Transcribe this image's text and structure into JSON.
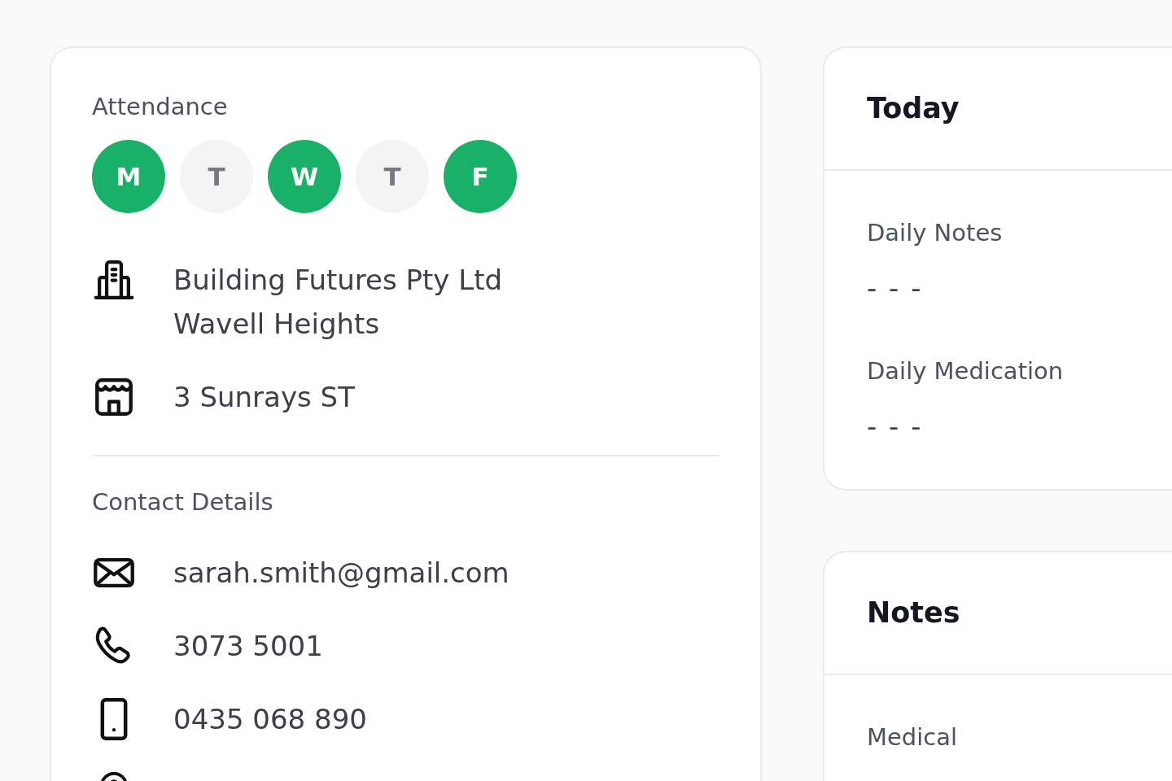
{
  "attendance": {
    "label": "Attendance",
    "days": [
      {
        "letter": "M",
        "selected": true
      },
      {
        "letter": "T",
        "selected": false
      },
      {
        "letter": "W",
        "selected": true
      },
      {
        "letter": "T",
        "selected": false
      },
      {
        "letter": "F",
        "selected": true
      }
    ]
  },
  "places": [
    {
      "kind": "building",
      "lines": [
        "Building Futures Pty Ltd",
        "Wavell Heights"
      ]
    },
    {
      "kind": "store",
      "lines": [
        "3 Sunrays ST"
      ]
    }
  ],
  "contact": {
    "label": "Contact Details",
    "items": [
      {
        "kind": "email",
        "value": "sarah.smith@gmail.com"
      },
      {
        "kind": "phone",
        "value": "3073 5001"
      },
      {
        "kind": "mobile",
        "value": "0435 068 890"
      },
      {
        "kind": "location"
      }
    ]
  },
  "today": {
    "title": "Today",
    "fields": [
      {
        "label": "Daily Notes",
        "value": "- - -"
      },
      {
        "label": "Daily Medication",
        "value": "- - -"
      }
    ]
  },
  "notes": {
    "title": "Notes",
    "fields": [
      {
        "label": "Medical"
      }
    ]
  }
}
